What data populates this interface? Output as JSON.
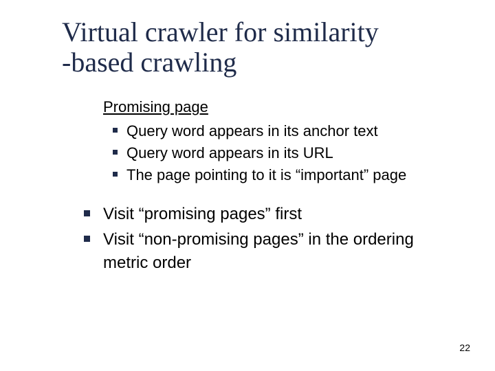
{
  "title_line1": "Virtual crawler for similarity",
  "title_line2": "-based crawling",
  "subheading": "Promising page",
  "subitems": [
    "Query word appears in its anchor text",
    "Query word appears in its URL",
    "The page pointing to it is “important” page"
  ],
  "mainitems": [
    "Visit “promising pages” first",
    "Visit “non-promising pages” in the ordering metric order"
  ],
  "page_number": "22"
}
